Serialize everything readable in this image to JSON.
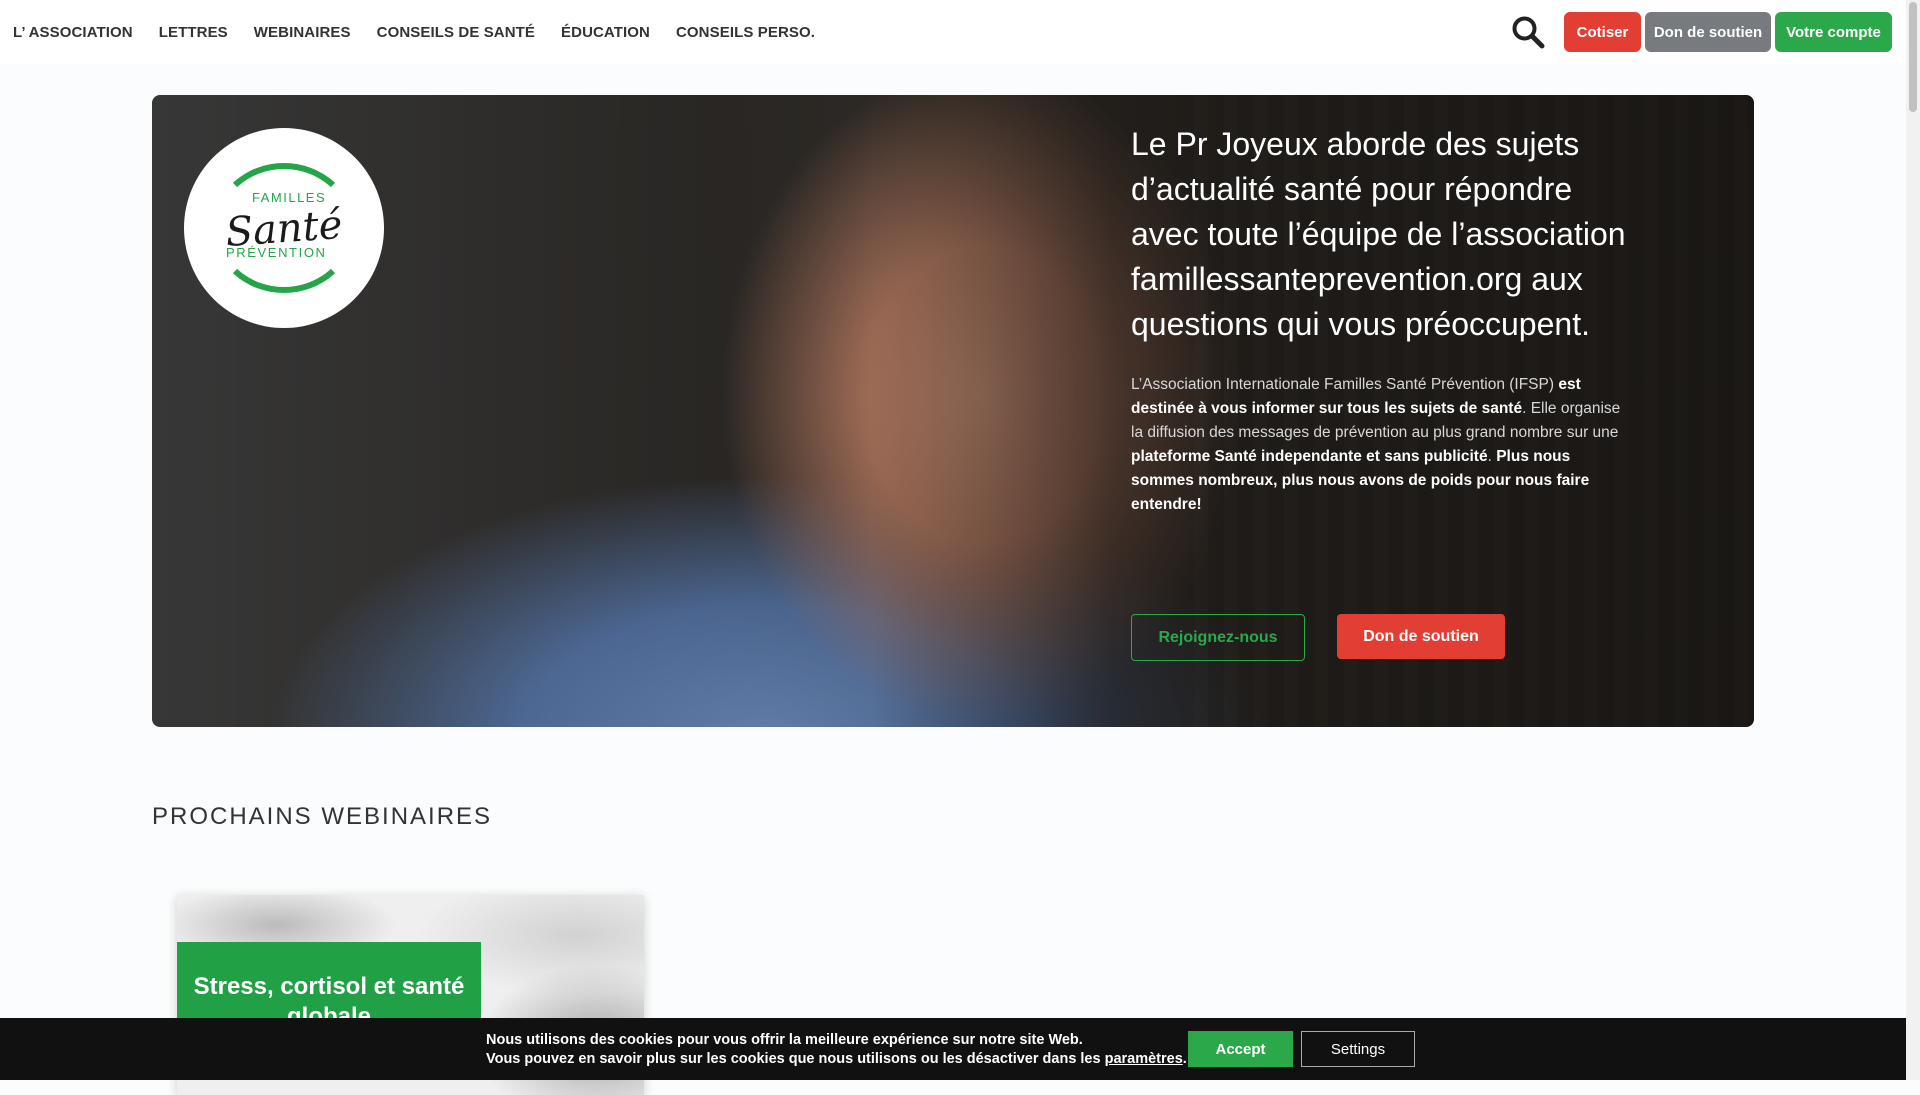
{
  "nav": {
    "items": [
      {
        "label": "L’ ASSOCIATION",
        "name": "nav-item-association"
      },
      {
        "label": "LETTRES",
        "name": "nav-item-lettres"
      },
      {
        "label": "WEBINAIRES",
        "name": "nav-item-webinaires"
      },
      {
        "label": "CONSEILS DE SANTÉ",
        "name": "nav-item-conseils-sante"
      },
      {
        "label": "ÉDUCATION",
        "name": "nav-item-education"
      },
      {
        "label": "CONSEILS PERSO.",
        "name": "nav-item-conseils-perso"
      }
    ],
    "actions": {
      "cotiser": "Cotiser",
      "don": "Don de soutien",
      "compte": "Votre compte"
    }
  },
  "hero": {
    "logo": {
      "top": "FAMILLES",
      "script": "Santé",
      "bottom": "PRÉVENTION"
    },
    "headline": "Le Pr Joyeux aborde des sujets d’actualité santé pour répondre avec toute l’équipe de l’association famillessanteprevention.org aux questions qui vous préoccupent.",
    "description": {
      "p1": "L’Association Internationale Familles Santé Prévention (IFSP) ",
      "b1": "est destinée à vous informer sur tous les sujets de santé",
      "p2": ". Elle organise la diffusion des messages de prévention au plus grand nombre sur une ",
      "b2": "plateforme Santé independante et sans publicité",
      "p3": ". ",
      "b3": "Plus nous sommes nombreux, plus nous avons de poids pour nous faire entendre!"
    },
    "button_join": "Rejoignez-nous",
    "button_donate": "Don de soutien"
  },
  "section": {
    "title": "PROCHAINS WEBINAIRES",
    "cards": [
      {
        "title": "Stress, cortisol et santé globale"
      }
    ]
  },
  "cookie": {
    "line1": "Nous utilisons des cookies pour vous offrir la meilleure expérience sur notre site Web.",
    "line2_prefix": "Vous pouvez en savoir plus sur les cookies que nous utilisons ou les désactiver dans les ",
    "line2_link": "paramètres",
    "line2_suffix": ".",
    "accept": "Accept",
    "settings": "Settings"
  },
  "colors": {
    "brand_green": "#2ba84a",
    "brand_red": "#e23e34",
    "grey_button": "#777a7e",
    "cookie_bg": "#111111"
  },
  "icons": {
    "search": "search-icon"
  }
}
